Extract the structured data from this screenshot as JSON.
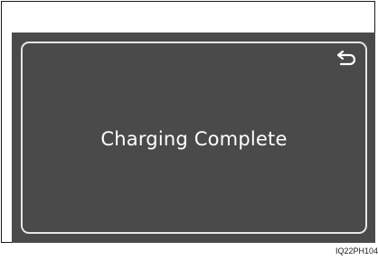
{
  "screen": {
    "message": "Charging Complete",
    "back_icon": "return-arrow-icon"
  },
  "figure": {
    "code": "IQ22PH104"
  },
  "colors": {
    "screen_background": "#4a4a4a",
    "panel_border": "#e6e6e6",
    "text": "#ffffff"
  }
}
